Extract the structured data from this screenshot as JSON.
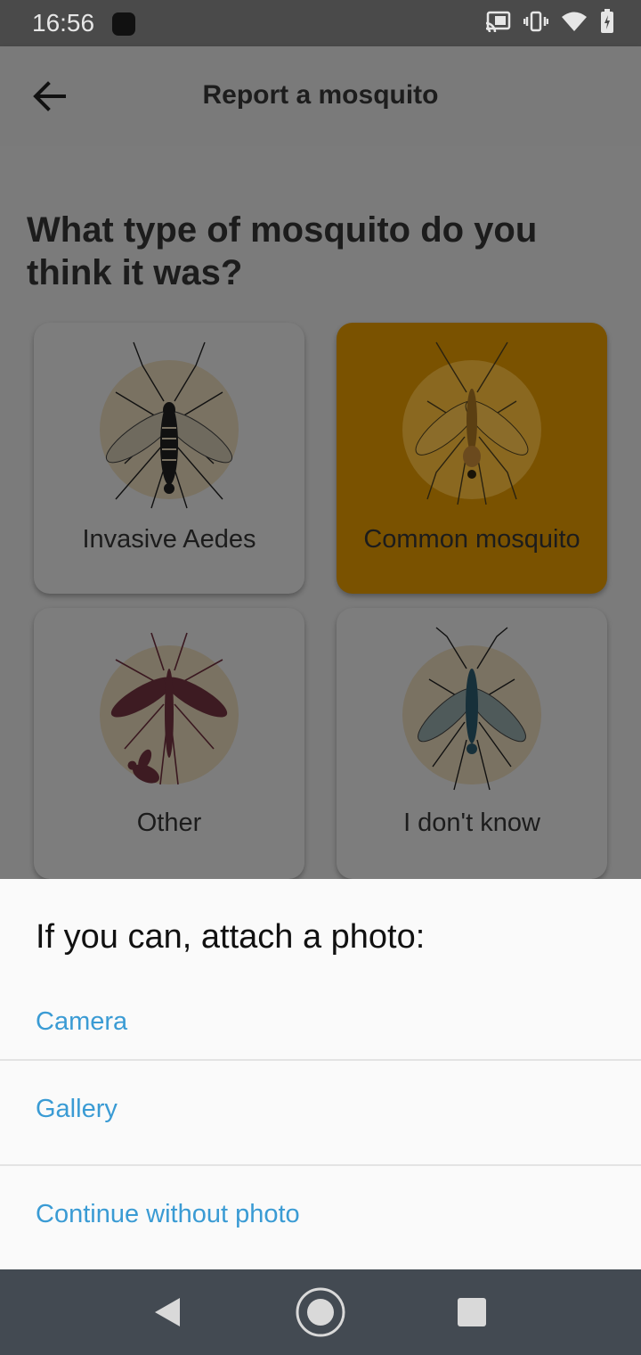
{
  "status_bar": {
    "time": "16:56",
    "icons": [
      "cast-icon",
      "vibrate-icon",
      "wifi-icon",
      "battery-icon"
    ]
  },
  "app_bar": {
    "title": "Report a mosquito",
    "back_icon": "arrow-left-icon"
  },
  "main": {
    "question": "What type of mosquito do you think it was?",
    "options": [
      {
        "label": "Invasive Aedes",
        "selected": false,
        "icon": "aedes-mosquito-icon"
      },
      {
        "label": "Common mosquito",
        "selected": true,
        "icon": "common-mosquito-icon"
      },
      {
        "label": "Other",
        "selected": false,
        "icon": "other-insect-icon"
      },
      {
        "label": "I don't know",
        "selected": false,
        "icon": "unknown-mosquito-icon"
      }
    ]
  },
  "sheet": {
    "heading": "If you can, attach a photo:",
    "options": [
      "Camera",
      "Gallery",
      "Continue without photo"
    ],
    "link_color": "#3a9bd4"
  },
  "colors": {
    "selected_card": "#f0a000",
    "scrim": "rgba(0,0,0,0.5)"
  }
}
